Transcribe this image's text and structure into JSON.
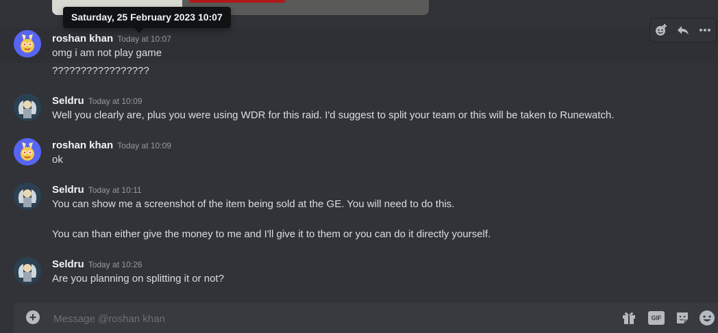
{
  "tooltip": {
    "text": "Saturday, 25 February 2023 10:07"
  },
  "action_bar": {
    "icons": [
      "add-reaction-icon",
      "reply-icon",
      "more-icon"
    ]
  },
  "messages": [
    {
      "author": "roshan khan",
      "time": "Today at 10:07",
      "lines": [
        "omg i am not play game",
        "?????????????????"
      ]
    },
    {
      "author": "Seldru",
      "time": "Today at 10:09",
      "lines": [
        "Well you clearly are, plus you were using WDR for this raid. I'd suggest to split your team or this will be taken to Runewatch."
      ]
    },
    {
      "author": "roshan khan",
      "time": "Today at 10:09",
      "lines": [
        "ok"
      ]
    },
    {
      "author": "Seldru",
      "time": "Today at 10:11",
      "lines": [
        "You can show me a screenshot of the item being sold at the GE. You will need to do this.",
        "You can than either give the money to me and I'll give it to them or you can do it directly yourself."
      ]
    },
    {
      "author": "Seldru",
      "time": "Today at 10:26",
      "lines": [
        "Are you planning on splitting it or not?"
      ]
    }
  ],
  "composer": {
    "placeholder": "Message @roshan khan",
    "gif_label": "GIF",
    "icons": [
      "plus-icon",
      "gift-icon",
      "gif-icon",
      "sticker-icon",
      "emoji-icon"
    ]
  },
  "colors": {
    "background": "#313338",
    "composer": "#383a40",
    "tooltip": "#111214",
    "brand": "#5865f2"
  }
}
